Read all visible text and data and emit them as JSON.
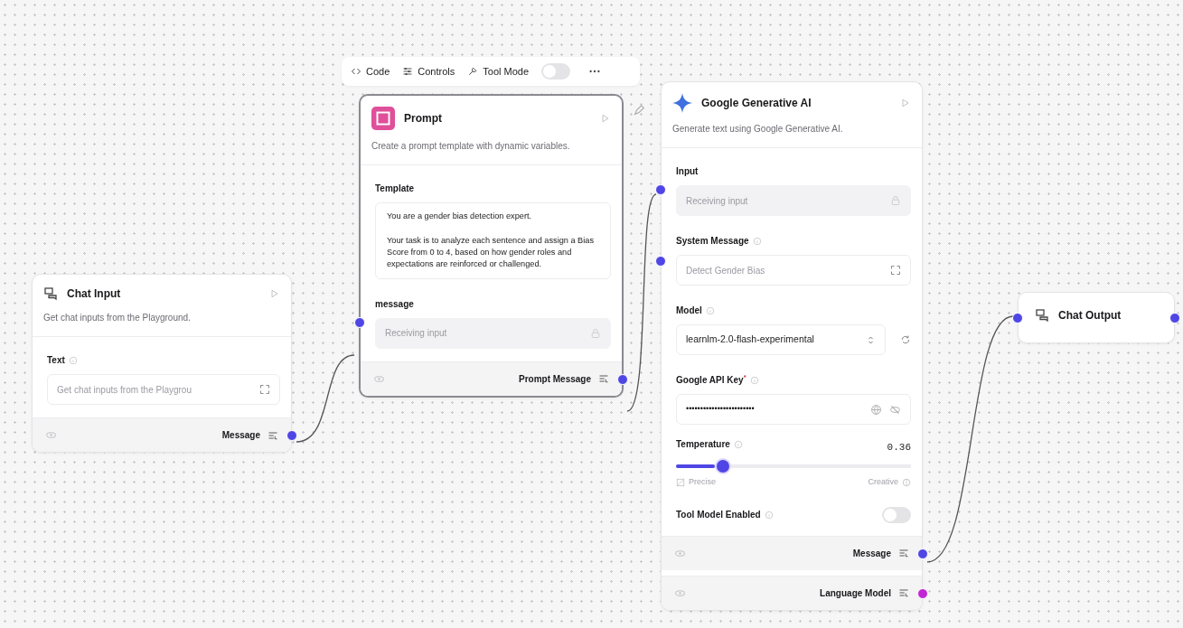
{
  "toolbar": {
    "items": [
      {
        "kind": "code",
        "label": "Code"
      },
      {
        "kind": "controls",
        "label": "Controls"
      },
      {
        "kind": "tool",
        "label": "Tool Mode"
      }
    ],
    "tool_mode_on": false
  },
  "nodes": [
    {
      "kind": "chat_input",
      "title": "Chat Input",
      "description": "Get chat inputs from the Playground.",
      "selected": false,
      "fields": [
        {
          "kind": "expand",
          "label": "Text",
          "info": true,
          "placeholder": "Get chat inputs from the Playgrou"
        }
      ],
      "outputs": [
        {
          "label": "Message",
          "color": "#4f46e5"
        }
      ]
    },
    {
      "kind": "prompt",
      "title": "Prompt",
      "description": "Create a prompt template with dynamic variables.",
      "selected": true,
      "fields": [
        {
          "kind": "textarea",
          "label": "Template",
          "info": false,
          "value": "You are a gender bias detection expert.\n\nYour task is to analyze each sentence and assign a Bias Score from 0 to 4, based on how gender roles and expectations are reinforced or challenged."
        },
        {
          "kind": "receiving",
          "label": "message",
          "info": false,
          "placeholder": "Receiving input",
          "color": "#4f46e5"
        }
      ],
      "outputs": [
        {
          "label": "Prompt Message",
          "color": "#4f46e5"
        }
      ]
    },
    {
      "kind": "google",
      "title": "Google Generative AI",
      "description": "Generate text using Google Generative AI.",
      "selected": false,
      "fields": [
        {
          "kind": "receiving",
          "label": "Input",
          "info": false,
          "placeholder": "Receiving input",
          "color": "#4f46e5"
        },
        {
          "kind": "expand",
          "label": "System Message",
          "info": true,
          "placeholder": "Detect Gender Bias",
          "color": "#4f46e5"
        },
        {
          "kind": "select",
          "label": "Model",
          "info": true,
          "value": "learnlm-2.0-flash-experimental"
        },
        {
          "kind": "password",
          "label": "Google API Key$^{*}$",
          "info": true,
          "value": "••••••••••••••••••••••••"
        },
        {
          "kind": "slider",
          "label": "Temperature",
          "info": true,
          "reading": "0.36",
          "level": 0.2,
          "min_label": "Precise",
          "max_label": "Creative"
        },
        {
          "kind": "toggle",
          "label": "Tool Model Enabled",
          "info": true,
          "on": false
        }
      ],
      "outputs": [
        {
          "label": "Message",
          "color": "#4f46e5"
        },
        {
          "label": "Language Model",
          "color": "#c026d3"
        }
      ]
    },
    {
      "kind": "chat_output",
      "title": "Chat Output",
      "selected": false,
      "in_handle": {
        "color": "#4f46e5"
      },
      "out_handle": {
        "color": "#4f46e5"
      }
    }
  ]
}
